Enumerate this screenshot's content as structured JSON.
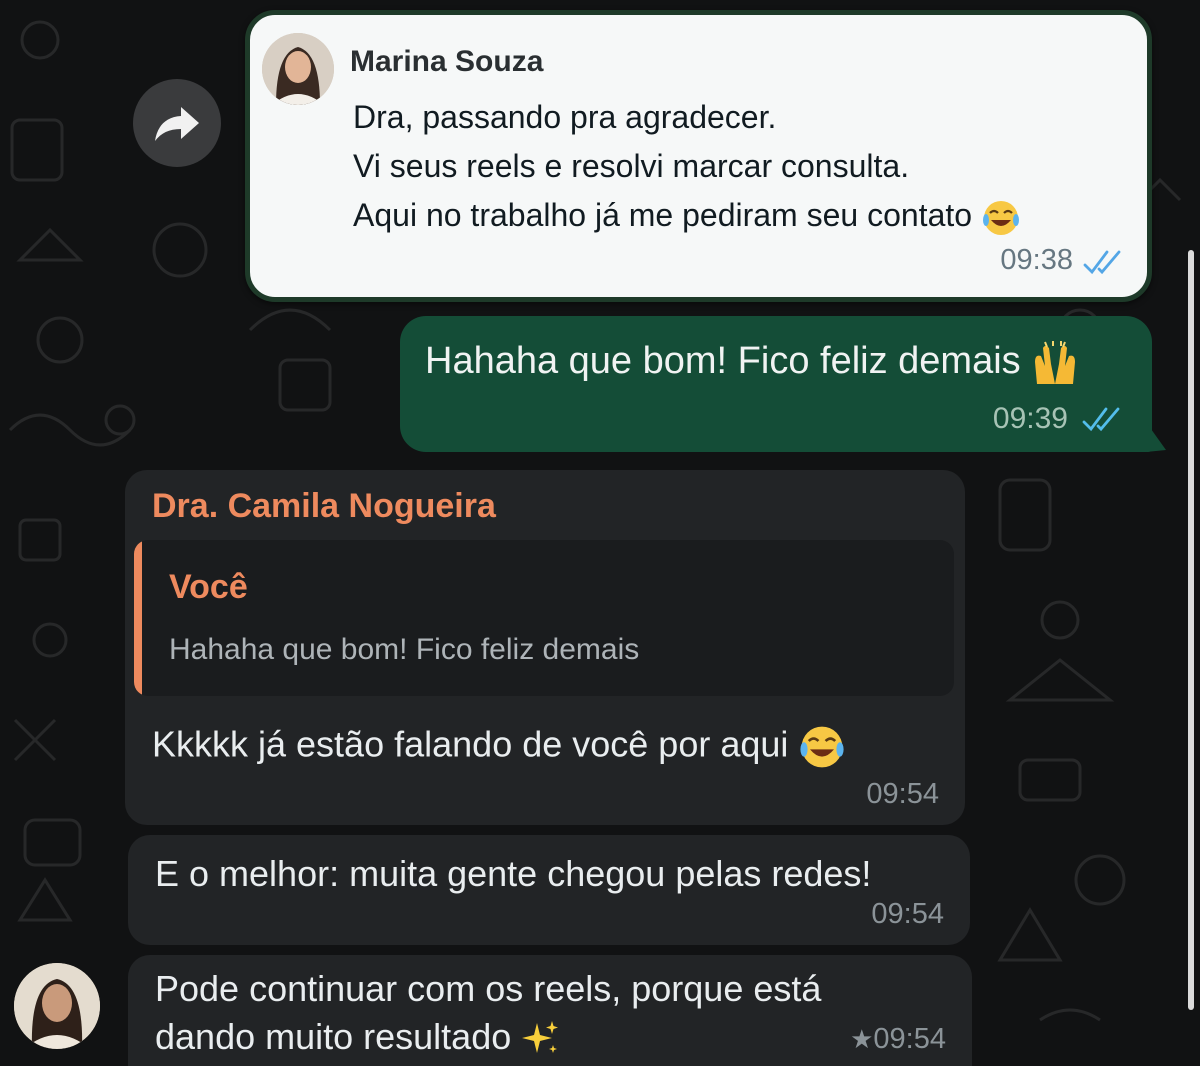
{
  "forwarded": {
    "sender_name": "Marina Souza",
    "lines": [
      "Dra, passando pra agradecer.",
      "Vi seus reels e resolvi marcar consulta.",
      "Aqui no trabalho já me pediram seu contato"
    ],
    "time": "09:38"
  },
  "outgoing": {
    "text": "Hahaha que bom! Fico feliz demais",
    "time": "09:39"
  },
  "incoming": {
    "sender_name": "Dra. Camila Nogueira",
    "quote": {
      "author": "Você",
      "text": "Hahaha que bom! Fico feliz demais"
    },
    "messages": [
      {
        "text": "Kkkkk já estão falando de você por aqui",
        "time": "09:54"
      },
      {
        "text": "E o melhor: muita gente chegou pelas redes!",
        "time": "09:54"
      },
      {
        "text": "Pode continuar com os reels, porque está dando muito resultado",
        "time": "09:54",
        "starred": true
      }
    ]
  },
  "icons": [
    "forward-icon",
    "read-receipts-icon",
    "star-icon",
    "joy-emoji-icon",
    "raising-hands-emoji-icon",
    "sparkles-emoji-icon"
  ],
  "colors": {
    "background": "#111213",
    "incoming_bubble": "#222426",
    "outgoing_bubble": "#144d37",
    "sender_accent": "#ee8a5e",
    "read_tick": "#53bdeb"
  }
}
